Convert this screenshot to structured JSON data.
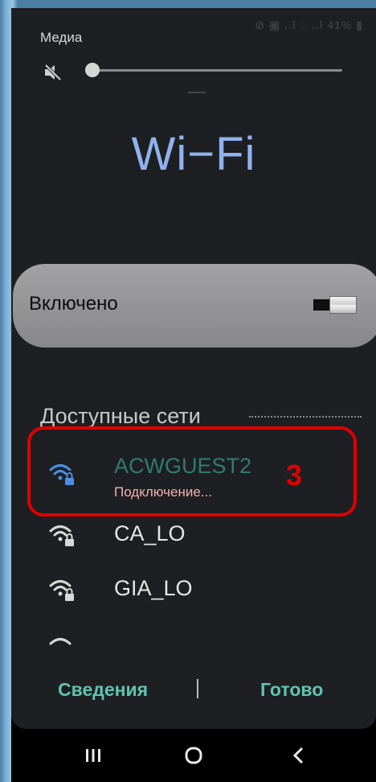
{
  "header": {
    "media_label": "Медиа",
    "status_text": "⊘ ▣ ..l ◌ ..l 41% ▮"
  },
  "volume": {
    "level_fraction": 0.0,
    "muted": true
  },
  "title": "Wi−Fi",
  "toggle": {
    "label": "Включено",
    "on": true
  },
  "networks_section": {
    "title": "Доступные сети"
  },
  "networks": [
    {
      "name": "ACWGUEST2",
      "status": "Подключение...",
      "name_color": "#2e7d6c",
      "icon_color": "#4a8ee6"
    },
    {
      "name": "CA_LO",
      "status": "",
      "name_color": "#e6e6e6",
      "icon_color": "#d8d8d8"
    },
    {
      "name": "GIA_LO",
      "status": "",
      "name_color": "#e6e6e6",
      "icon_color": "#d8d8d8"
    }
  ],
  "annotation": {
    "step_number": "3"
  },
  "footer": {
    "details_label": "Сведения",
    "done_label": "Готово"
  },
  "colors": {
    "accent": "#5fc4b0",
    "title": "#8fb3ee",
    "highlight": "#e00000"
  },
  "icons": {
    "mute": "speaker-muted-icon",
    "wifi_secure": "wifi-lock-icon",
    "nav_recent": "recent-apps-icon",
    "nav_home": "home-icon",
    "nav_back": "back-icon"
  }
}
